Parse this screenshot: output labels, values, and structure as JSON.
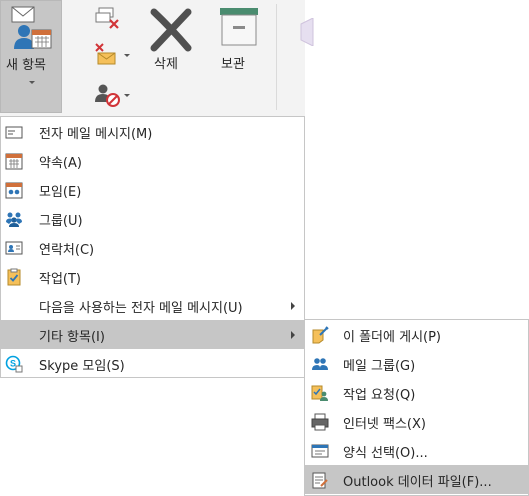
{
  "ribbon": {
    "new_items_label": "새 항목",
    "delete_label": "삭제",
    "archive_label": "보관"
  },
  "menu": {
    "items": [
      {
        "label": "전자 메일 메시지(M)",
        "icon": "email-message-icon"
      },
      {
        "label": "약속(A)",
        "icon": "calendar-appointment-icon"
      },
      {
        "label": "모임(E)",
        "icon": "meeting-icon"
      },
      {
        "label": "그룹(U)",
        "icon": "group-icon"
      },
      {
        "label": "연락처(C)",
        "icon": "contact-card-icon"
      },
      {
        "label": "작업(T)",
        "icon": "task-clipboard-icon"
      },
      {
        "label": "다음을 사용하는 전자 메일 메시지(U)"
      },
      {
        "label": "기타 항목(I)"
      },
      {
        "label": "Skype 모임(S)",
        "icon": "skype-meeting-icon"
      }
    ]
  },
  "submenu": {
    "items": [
      {
        "label": "이 폴더에 게시(P)",
        "icon": "post-to-folder-icon"
      },
      {
        "label": "메일 그룹(G)",
        "icon": "mail-group-icon"
      },
      {
        "label": "작업 요청(Q)",
        "icon": "task-request-icon"
      },
      {
        "label": "인터넷 팩스(X)",
        "icon": "internet-fax-icon"
      },
      {
        "label": "양식 선택(O)...",
        "icon": "choose-form-icon"
      },
      {
        "label": "Outlook 데이터 파일(F)...",
        "icon": "outlook-data-file-icon"
      }
    ]
  }
}
